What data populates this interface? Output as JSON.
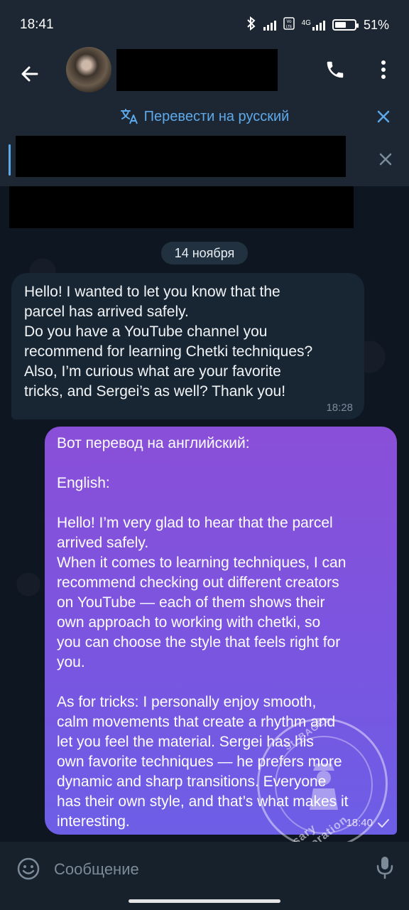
{
  "status_bar": {
    "time": "18:41",
    "network": "4G",
    "battery": "51%",
    "icons": [
      "bluetooth-icon",
      "signal-icon",
      "volte-icon",
      "signal-4g-icon",
      "battery-icon"
    ]
  },
  "header": {
    "icons": [
      "back-arrow-icon",
      "phone-icon",
      "more-vert-icon"
    ]
  },
  "translate_bar": {
    "label": "Перевести на русский",
    "icons": [
      "translate-icon",
      "close-icon"
    ]
  },
  "chat": {
    "date_separator": "14 ноября",
    "messages": [
      {
        "direction": "incoming",
        "text": "Hello! I wanted to let you know that the\nparcel has arrived safely.\nDo you have a YouTube channel you\nrecommend for learning Chetki techniques?\nAlso, I’m curious what are your favorite\ntricks, and Sergei’s as well? Thank you!",
        "time": "18:28"
      },
      {
        "direction": "outgoing",
        "text": "Вот перевод на английский:\n\nEnglish:\n\nHello! I’m very glad to hear that the parcel\narrived safely.\nWhen it comes to learning techniques, I can\nrecommend checking out different creators\non YouTube — each of them shows their\nown approach to working with chetki, so\nyou can choose the style that feels right for\nyou.\n\nAs for tricks: I personally enjoy smooth,\ncalm movements that create a rhythm and\nlet you feel the material. Sergei has his\nown favorite techniques — he prefers more\ndynamic and sharp transitions. Everyone\nhas their own style, and that’s what makes it\ninteresting.",
        "time": "18:40",
        "status_icon": "check-icon"
      }
    ]
  },
  "watermark": {
    "top_text": "St. BAGEL",
    "bottom_text": "Rosary Corporation"
  },
  "composer": {
    "placeholder": "Сообщение",
    "value": "",
    "icons": [
      "emoji-icon",
      "mic-icon"
    ]
  },
  "colors": {
    "background": "#0e1621",
    "header": "#1c2733",
    "accent": "#5ea9ea",
    "incoming_bubble": "#182533",
    "outgoing_bubble_top": "#8a4fd8",
    "outgoing_bubble_bottom": "#6d5ee6"
  }
}
